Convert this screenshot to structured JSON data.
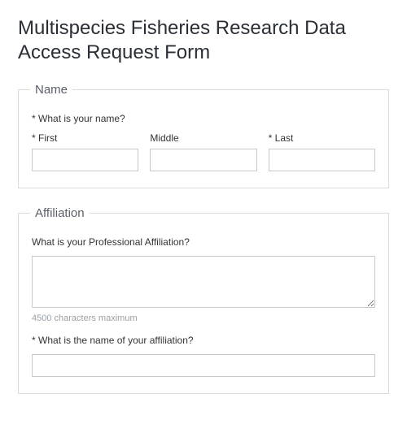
{
  "title": "Multispecies Fisheries Research Data Access Request Form",
  "sections": {
    "name": {
      "legend": "Name",
      "question": "What is your name?",
      "fields": {
        "first": {
          "label": "First",
          "value": ""
        },
        "middle": {
          "label": "Middle",
          "value": ""
        },
        "last": {
          "label": "Last",
          "value": ""
        }
      }
    },
    "affiliation": {
      "legend": "Affiliation",
      "prof_question": "What is your Professional Affiliation?",
      "prof_value": "",
      "prof_hint": "4500 characters maximum",
      "name_question": "What is the name of your affiliation?",
      "name_value": ""
    }
  }
}
